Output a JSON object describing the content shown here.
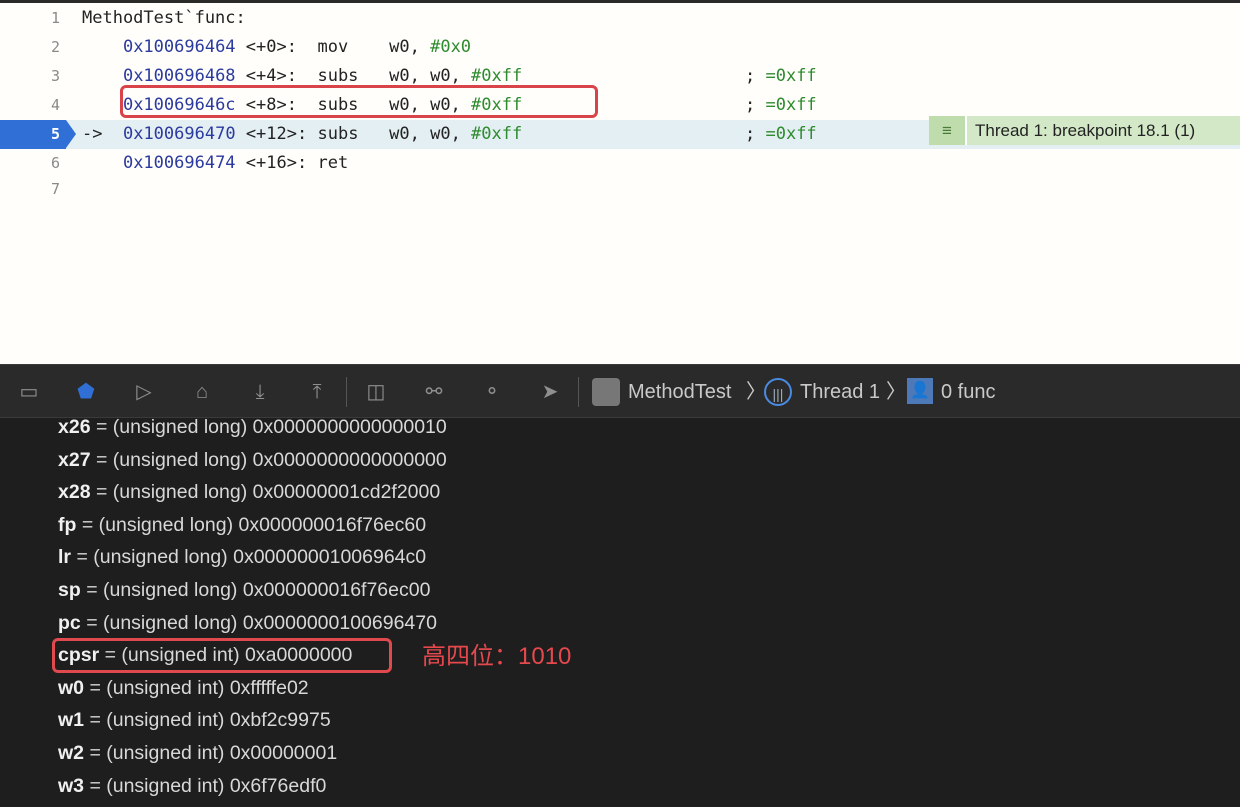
{
  "editor": {
    "lines": [
      {
        "n": "1",
        "label": "MethodTest`func:"
      },
      {
        "n": "2",
        "addr": "0x100696464",
        "off": "<+0>:",
        "op": "mov",
        "args": "w0, ",
        "imm": "#0x0"
      },
      {
        "n": "3",
        "addr": "0x100696468",
        "off": "<+4>:",
        "op": "subs",
        "args": "w0, w0, ",
        "imm": "#0xff",
        "comment": "=0xff"
      },
      {
        "n": "4",
        "addr": "0x10069646c",
        "off": "<+8>:",
        "op": "subs",
        "args": "w0, w0, ",
        "imm": "#0xff",
        "comment": "=0xff"
      },
      {
        "n": "5",
        "arrow": "->",
        "addr": "0x100696470",
        "off": "<+12>:",
        "op": "subs",
        "args": "w0, w0, ",
        "imm": "#0xff",
        "comment": "=0xff"
      },
      {
        "n": "6",
        "addr": "0x100696474",
        "off": "<+16>:",
        "op": "ret"
      },
      {
        "n": "7"
      }
    ],
    "breakpoint_label": "Thread 1: breakpoint 18.1 (1)"
  },
  "toolbar": {
    "crumbs": [
      "MethodTest",
      "Thread 1",
      "0 func"
    ]
  },
  "registers": [
    {
      "name": "x26",
      "type": "= (unsigned long)",
      "value": "0x0000000000000010"
    },
    {
      "name": "x27",
      "type": "= (unsigned long)",
      "value": "0x0000000000000000"
    },
    {
      "name": "x28",
      "type": "= (unsigned long)",
      "value": "0x00000001cd2f2000"
    },
    {
      "name": "fp",
      "type": "= (unsigned long)",
      "value": "0x000000016f76ec60"
    },
    {
      "name": "lr",
      "type": "= (unsigned long)",
      "value": "0x00000001006964c0"
    },
    {
      "name": "sp",
      "type": "= (unsigned long)",
      "value": "0x000000016f76ec00"
    },
    {
      "name": "pc",
      "type": "= (unsigned long)",
      "value": "0x0000000100696470"
    },
    {
      "name": "cpsr",
      "type": "= (unsigned int)",
      "value": "0xa0000000"
    },
    {
      "name": "w0",
      "type": "= (unsigned int)",
      "value": "0xfffffe02"
    },
    {
      "name": "w1",
      "type": "= (unsigned int)",
      "value": "0xbf2c9975"
    },
    {
      "name": "w2",
      "type": "= (unsigned int)",
      "value": "0x00000001"
    },
    {
      "name": "w3",
      "type": "= (unsigned int)",
      "value": "0x6f76edf0"
    }
  ],
  "annotation": "高四位：1010"
}
